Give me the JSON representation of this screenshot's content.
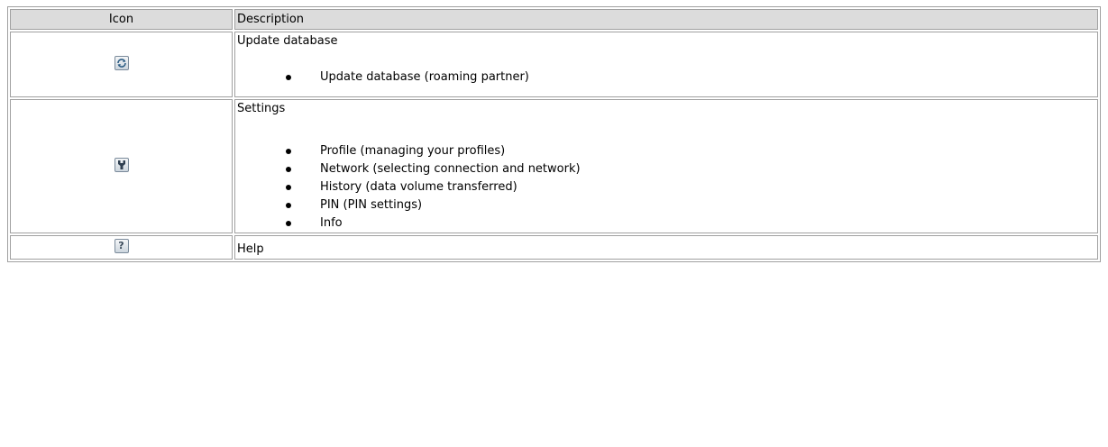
{
  "table": {
    "headers": {
      "icon": "Icon",
      "description": "Description"
    },
    "rows": [
      {
        "icon": "refresh-icon",
        "title": "Update database",
        "items": [
          "Update database (roaming partner)"
        ]
      },
      {
        "icon": "wrench-icon",
        "title": "Settings",
        "items": [
          "Profile (managing your profiles)",
          "Network (selecting connection and network)",
          "History (data volume transferred)",
          "PIN (PIN settings)",
          "Info"
        ]
      },
      {
        "icon": "help-icon",
        "title": "Help",
        "items": []
      }
    ]
  }
}
